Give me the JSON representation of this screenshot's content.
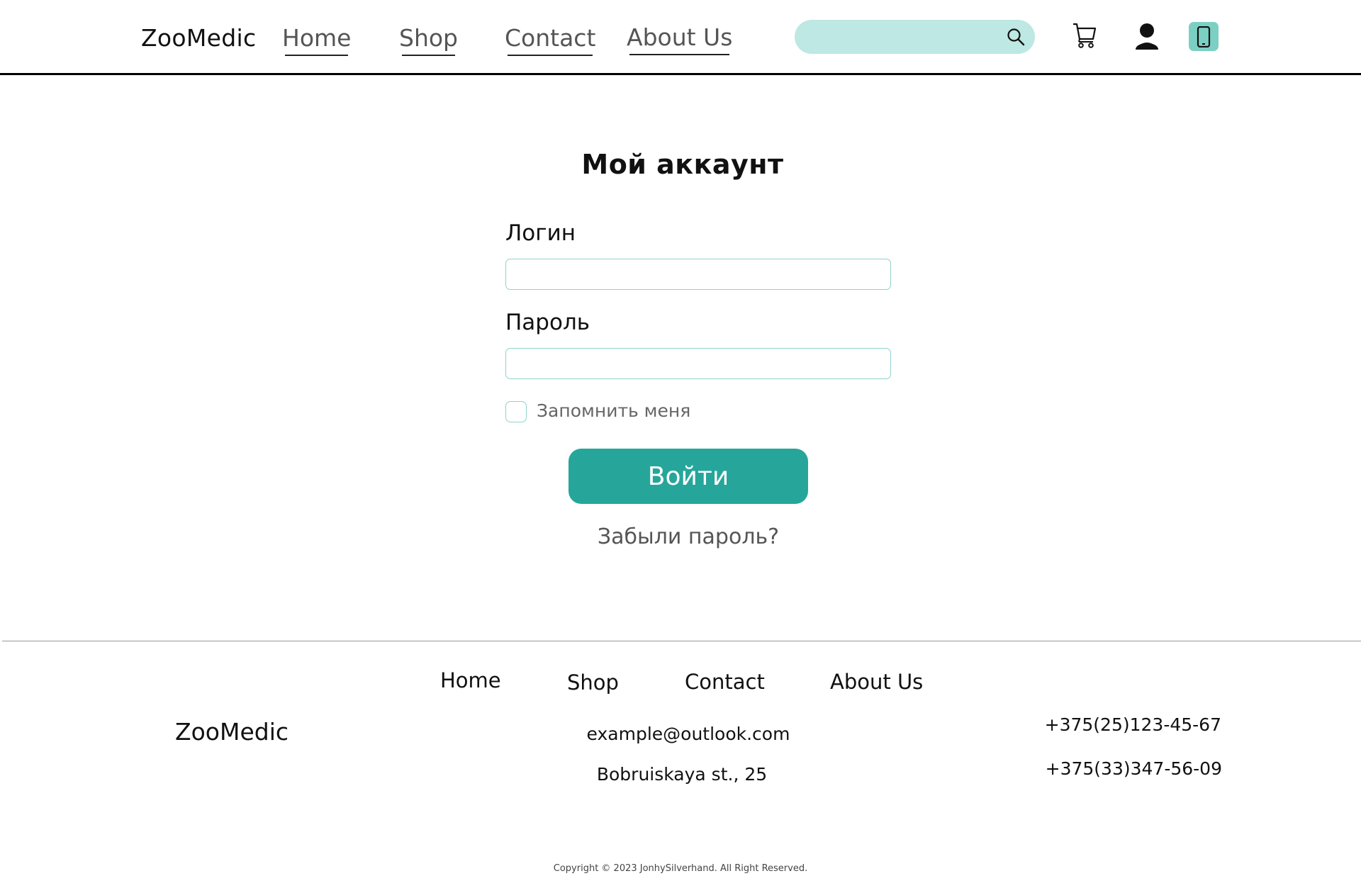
{
  "header": {
    "logo": "ZooMedic",
    "nav": [
      "Home",
      "Shop",
      "Contact",
      "About Us"
    ],
    "search": {
      "value": "",
      "placeholder": ""
    },
    "icons": [
      "search-icon",
      "cart-icon",
      "user-icon",
      "phone-icon"
    ]
  },
  "login": {
    "title": "Мой аккаунт",
    "login_label": "Логин",
    "login_value": "",
    "password_label": "Пароль",
    "password_value": "",
    "remember_label": "Запомнить меня",
    "remember_checked": false,
    "submit_label": "Войти",
    "forgot_label": "Забыли пароль?"
  },
  "footer": {
    "nav": [
      "Home",
      "Shop",
      "Contact",
      "About Us"
    ],
    "logo": "ZooMedic",
    "email": "example@outlook.com",
    "address": "Bobruiskaya st., 25",
    "phones": [
      "+375(25)123-45-67",
      "+375(33)347-56-09"
    ],
    "copyright": "Copyright © 2023 JonhySilverhand. All Right Reserved."
  },
  "colors": {
    "accent": "#26a69a",
    "accent_light": "#bde8e4",
    "phone_button": "#7ccfc3",
    "field_border": "#8fd3cb"
  }
}
